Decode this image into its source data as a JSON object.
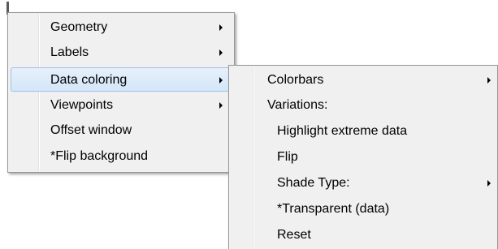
{
  "main_menu": {
    "items": [
      {
        "label": "Geometry",
        "has_submenu": true
      },
      {
        "label": "Labels",
        "has_submenu": true
      },
      {
        "label": "Data coloring",
        "has_submenu": true,
        "highlighted": true
      },
      {
        "label": "Viewpoints",
        "has_submenu": true
      },
      {
        "label": "Offset window",
        "has_submenu": false
      },
      {
        "label": "*Flip background",
        "has_submenu": false
      }
    ]
  },
  "submenu": {
    "items": [
      {
        "label": "Colorbars",
        "has_submenu": true
      },
      {
        "label": "Variations:",
        "has_submenu": false
      },
      {
        "label": "Highlight extreme data",
        "has_submenu": false
      },
      {
        "label": "Flip",
        "has_submenu": false
      },
      {
        "label": "Shade Type:",
        "has_submenu": true
      },
      {
        "label": "*Transparent (data)",
        "has_submenu": false
      },
      {
        "label": "Reset",
        "has_submenu": false
      }
    ]
  },
  "colors": {
    "menu_background": "#f0f0f0",
    "menu_border": "#979797",
    "highlight_fill": "#d9e8f8",
    "highlight_border": "#9cc3ea"
  }
}
